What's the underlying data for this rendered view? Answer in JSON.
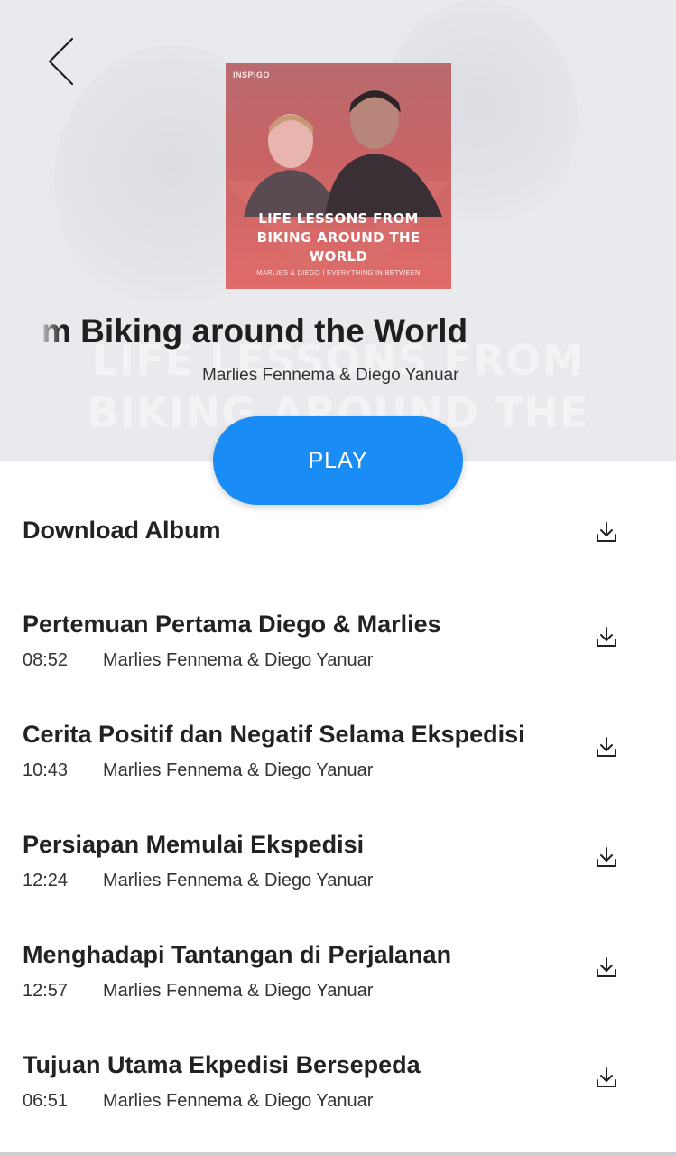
{
  "header": {
    "album_title": "m Biking around the World",
    "album_artist": "Marlies Fennema & Diego Yanuar",
    "bg_text_line1": "LIFE LESSONS FROM",
    "bg_text_line2": "BIKING AROUND THE WORLD"
  },
  "cover": {
    "brand": "INSPIGO",
    "title_line1": "LIFE LESSONS FROM",
    "title_line2": "BIKING AROUND THE WORLD",
    "subtitle": "MARLIES & DIEGO | EVERYTHING IN BETWEEN"
  },
  "play_button": {
    "label": "PLAY"
  },
  "download_album": {
    "label": "Download Album"
  },
  "tracks": [
    {
      "title": "Pertemuan Pertama Diego & Marlies",
      "duration": "08:52",
      "artist": "Marlies Fennema & Diego Yanuar"
    },
    {
      "title": "Cerita Positif dan Negatif Selama Ekspedisi",
      "duration": "10:43",
      "artist": "Marlies Fennema & Diego Yanuar"
    },
    {
      "title": "Persiapan Memulai Ekspedisi",
      "duration": "12:24",
      "artist": "Marlies Fennema & Diego Yanuar"
    },
    {
      "title": "Menghadapi Tantangan di Perjalanan",
      "duration": "12:57",
      "artist": "Marlies Fennema & Diego Yanuar"
    },
    {
      "title": "Tujuan Utama Ekpedisi Bersepeda",
      "duration": "06:51",
      "artist": "Marlies Fennema & Diego Yanuar"
    }
  ],
  "colors": {
    "accent": "#1a8cf5",
    "hero_bg": "#e9eaee",
    "cover_red": "#e06b68"
  },
  "icons": {
    "back": "chevron-left-icon",
    "download": "download-icon"
  }
}
